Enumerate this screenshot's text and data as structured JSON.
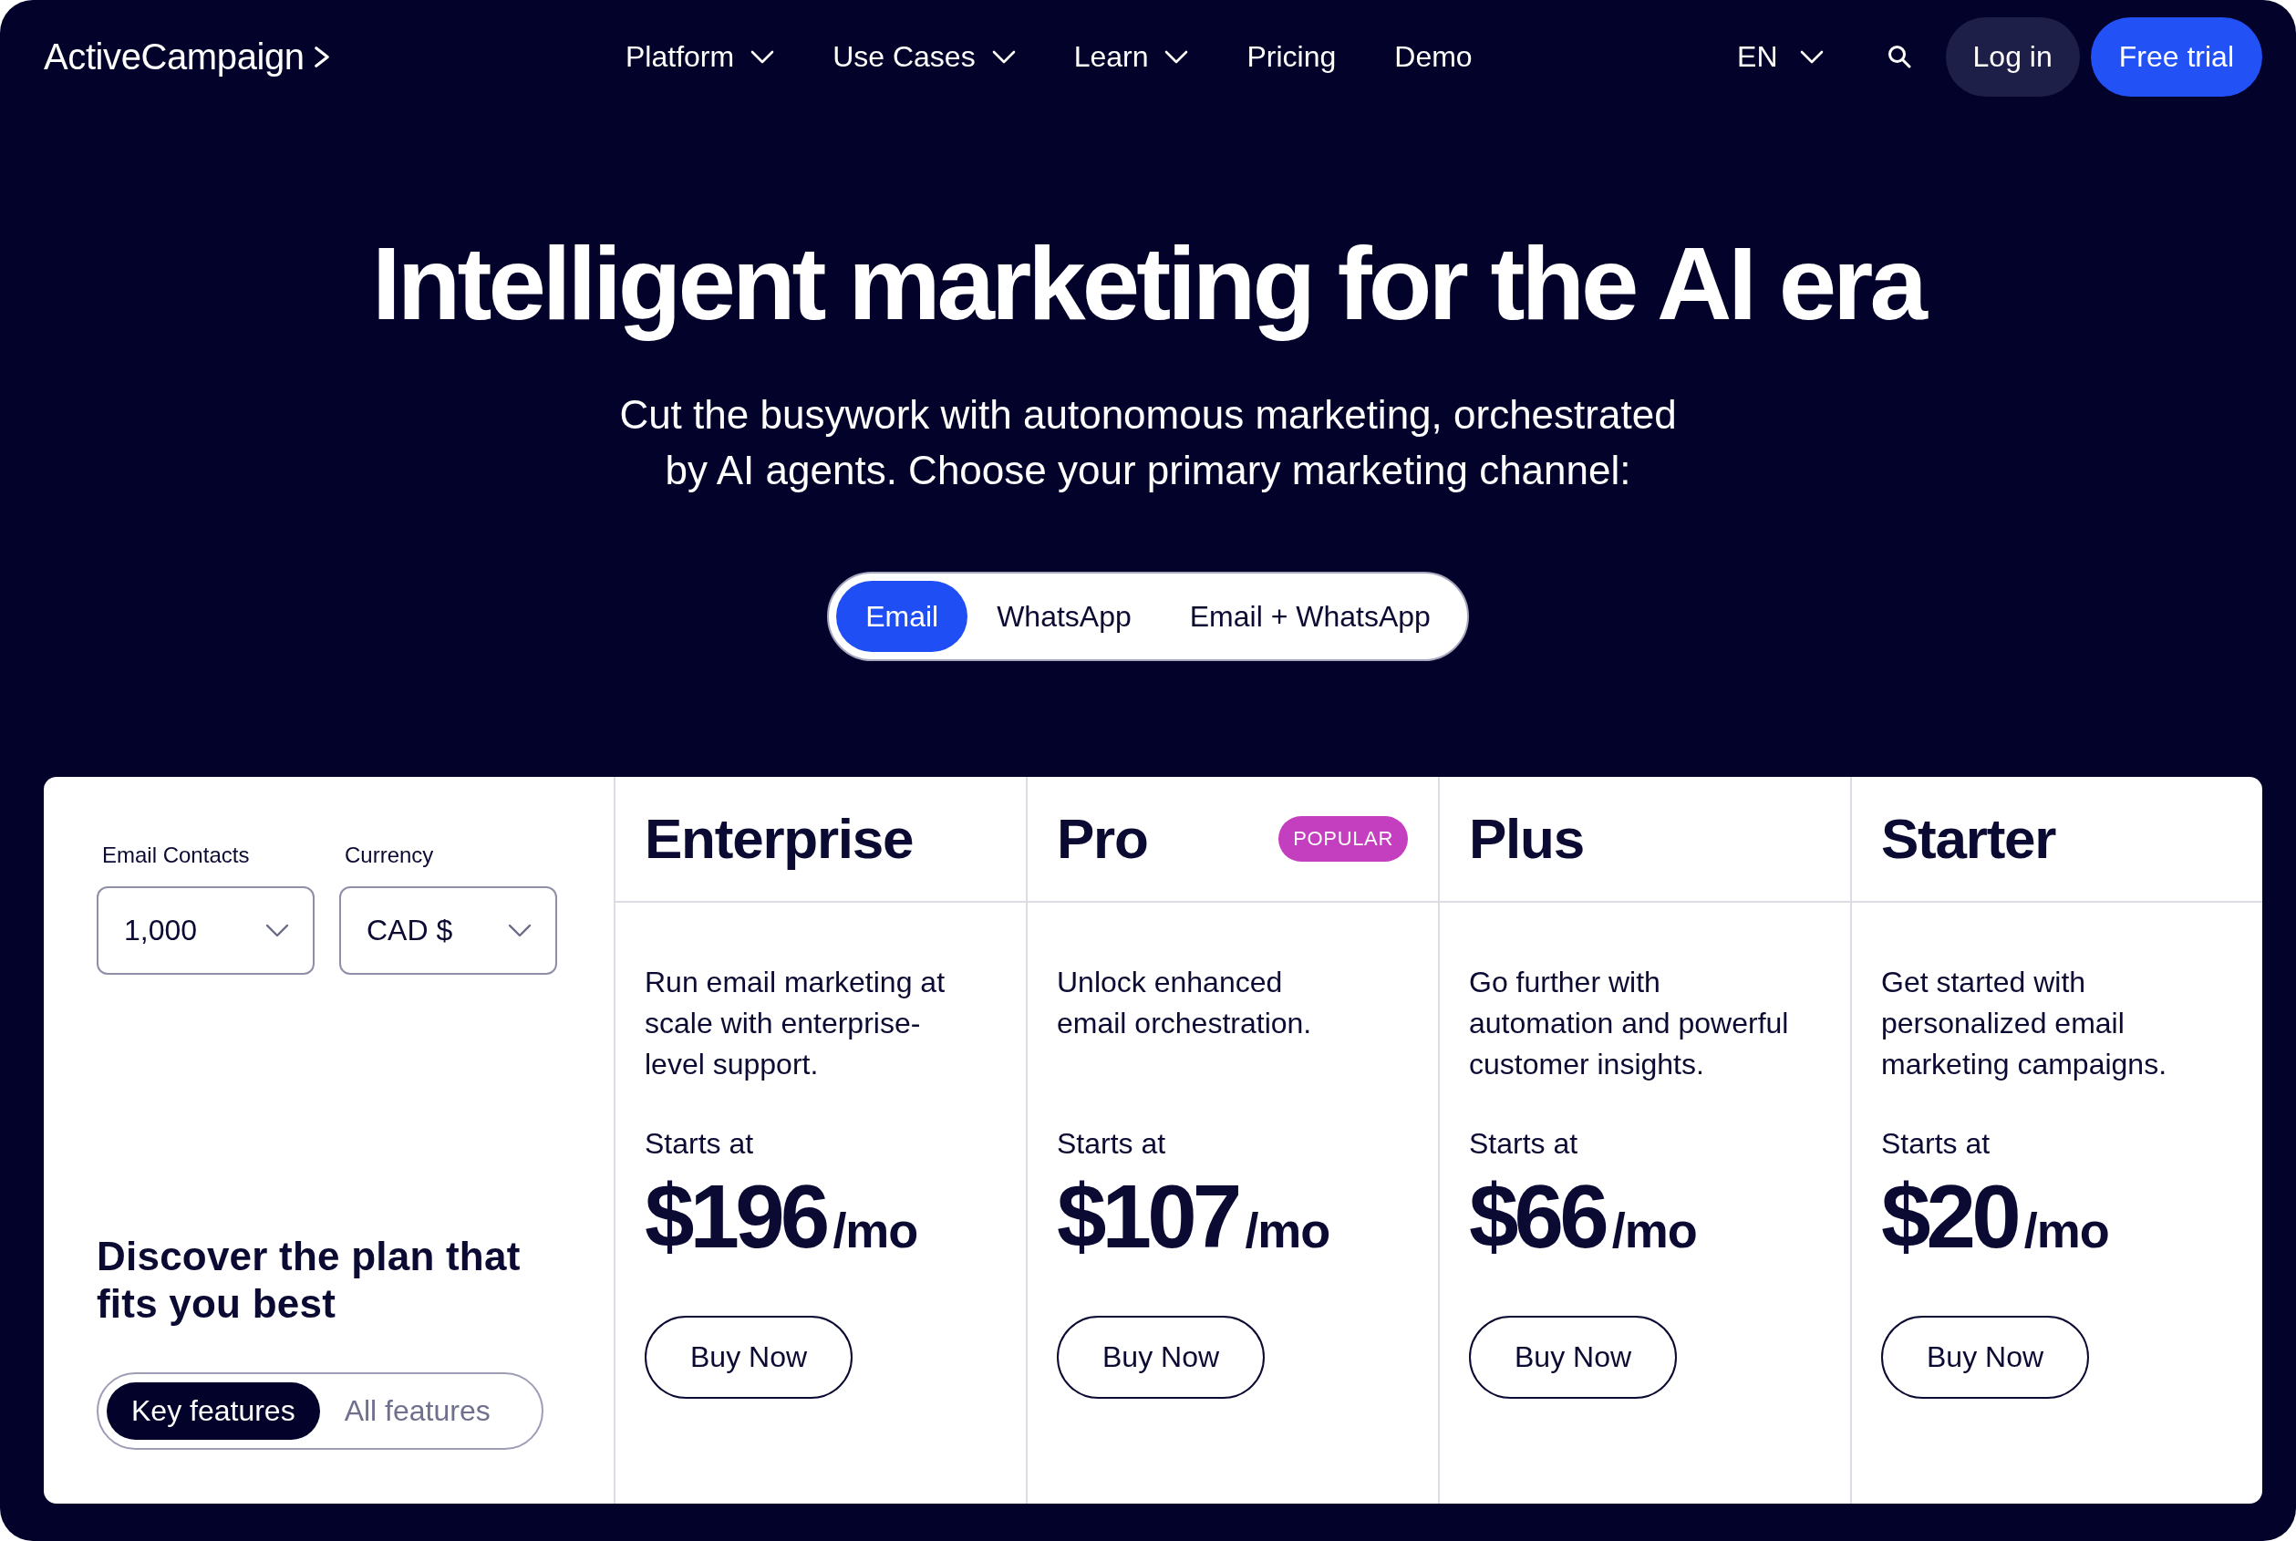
{
  "nav": {
    "logo": "ActiveCampaign",
    "items": [
      {
        "label": "Platform",
        "dropdown": true
      },
      {
        "label": "Use Cases",
        "dropdown": true
      },
      {
        "label": "Learn",
        "dropdown": true
      },
      {
        "label": "Pricing",
        "dropdown": false
      },
      {
        "label": "Demo",
        "dropdown": false
      }
    ],
    "language": "EN",
    "login": "Log in",
    "cta": "Free trial"
  },
  "hero": {
    "title": "Intelligent marketing for the AI era",
    "subtitle": "Cut the busywork with autonomous marketing, orchestrated by AI agents. Choose your primary marketing channel:",
    "channels": [
      {
        "label": "Email",
        "selected": true
      },
      {
        "label": "WhatsApp",
        "selected": false
      },
      {
        "label": "Email + WhatsApp",
        "selected": false
      }
    ]
  },
  "pricing": {
    "contacts": {
      "label": "Email Contacts",
      "value": "1,000"
    },
    "currency": {
      "label": "Currency",
      "value": "CAD $"
    },
    "heading": "Discover the plan that fits you best",
    "feature_views": [
      {
        "label": "Key features",
        "selected": true
      },
      {
        "label": "All features",
        "selected": false
      }
    ],
    "plans": [
      {
        "name": "Enterprise",
        "description": "Run email marketing at scale with enterprise-level support.",
        "starts_label": "Starts at",
        "price": "$196",
        "period": "/mo",
        "button": "Buy Now"
      },
      {
        "name": "Pro",
        "badge": "POPULAR",
        "description": "Unlock enhanced email orchestration.",
        "starts_label": "Starts at",
        "price": "$107",
        "period": "/mo",
        "button": "Buy Now"
      },
      {
        "name": "Plus",
        "description": "Go further with automation and powerful customer insights.",
        "starts_label": "Starts at",
        "price": "$66",
        "period": "/mo",
        "button": "Buy Now"
      },
      {
        "name": "Starter",
        "description": "Get started with personalized email marketing campaigns.",
        "starts_label": "Starts at",
        "price": "$20",
        "period": "/mo",
        "button": "Buy Now"
      }
    ]
  }
}
